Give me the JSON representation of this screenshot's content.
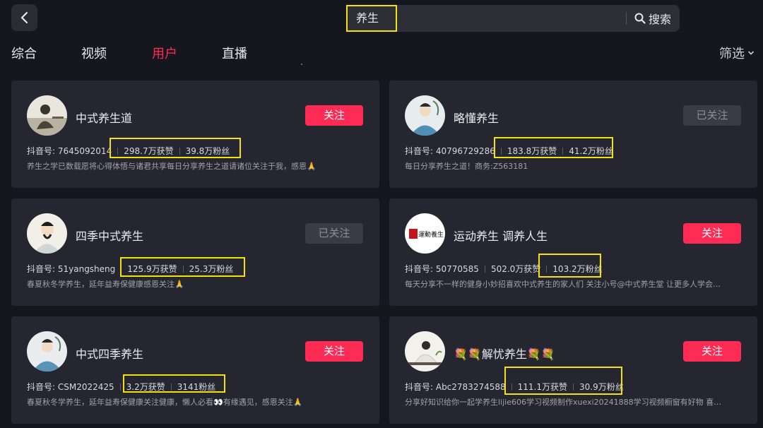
{
  "header": {
    "back_icon": "chevron-left-icon",
    "search": {
      "value": "养生",
      "button_label": "搜索",
      "button_icon": "search-icon"
    }
  },
  "tabs": [
    {
      "label": "综合",
      "active": false
    },
    {
      "label": "视频",
      "active": false
    },
    {
      "label": "用户",
      "active": true
    },
    {
      "label": "直播",
      "active": false
    }
  ],
  "filter": {
    "label": "筛选",
    "icon": "chevron-down-icon"
  },
  "colors": {
    "accent": "#fe2c55",
    "highlight": "#f5e20a",
    "background": "#16161f",
    "card": "#25262f"
  },
  "users": [
    {
      "name": "中式养生道",
      "follow_label": "关注",
      "followed": false,
      "id_text": "抖音号: 7645092014",
      "likes": "298.7万获赞",
      "fans": "39.8万粉丝",
      "desc": "养生之学已数载愿将心得体悟与诸君共享每日分享养生之道请诸位关注于我，感恩🙏"
    },
    {
      "name": "略懂养生",
      "follow_label": "已关注",
      "followed": true,
      "id_text": "抖音号: 40796729286",
      "likes": "183.8万获赞",
      "fans": "41.2万粉丝",
      "desc": "每日分享养生之道！商务:Z563181"
    },
    {
      "name": "四季中式养生",
      "follow_label": "已关注",
      "followed": true,
      "id_text": "抖音号: 51yangsheng",
      "likes": "125.9万获赞",
      "fans": "25.3万粉丝",
      "desc": "春夏秋冬学养生，延年益寿保健康感恩关注🙏"
    },
    {
      "name": "运动养生 调养人生",
      "follow_label": "关注",
      "followed": false,
      "id_text": "抖音号: 50770585",
      "likes": "502.0万获赞",
      "fans": "103.2万粉丝",
      "desc": "每天分享不一样的健身小妙招喜欢中式养生的家人们 关注小号@中式养生堂 让更多人学会…",
      "avatar_text": "運動養生"
    },
    {
      "name": "中式四季养生",
      "follow_label": "关注",
      "followed": false,
      "id_text": "抖音号: CSM2022425",
      "likes": "3.2万获赞",
      "fans": "3141粉丝",
      "desc": "春夏秋冬学养生，延年益寿保健康关注健康，懒人必看👀有缘遇见，感恩关注🙏"
    },
    {
      "name": "💐💐解忧养生💐💐",
      "follow_label": "关注",
      "followed": false,
      "id_text": "抖音号: Abc2783274588",
      "likes": "111.1万获赞",
      "fans": "30.9万粉丝",
      "desc": "分享好知识给你一起学养生lijie606学习视频制作xuexi20241888学习视频橱窗有好物 喜…"
    }
  ]
}
